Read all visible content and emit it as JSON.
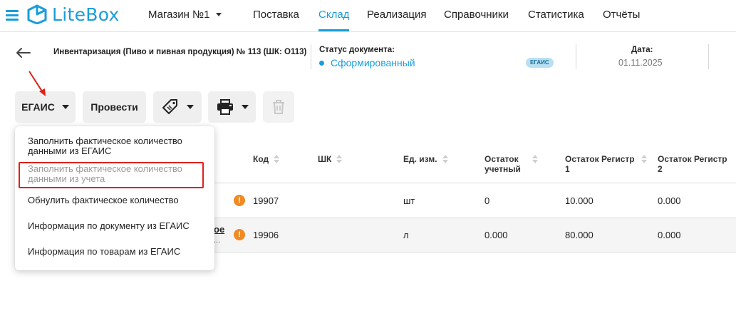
{
  "header": {
    "brand": "LiteBox",
    "store": "Магазин №1",
    "nav": [
      {
        "label": "Поставка"
      },
      {
        "label": "Склад",
        "active": true
      },
      {
        "label": "Реализация"
      },
      {
        "label": "Справочники"
      },
      {
        "label": "Статистика"
      },
      {
        "label": "Отчёты"
      }
    ]
  },
  "document": {
    "title": "Инвентаризация (Пиво и пивная продукция) № 113 (ШК: О113)",
    "status_label": "Статус документа:",
    "status_value": "Сформированный",
    "badge": "ЕГАИС",
    "date_label": "Дата:",
    "date_value": "01.11.2025"
  },
  "toolbar": {
    "egais_label": "ЕГАИС",
    "conduct_label": "Провести",
    "tag_icon": "price-tag-icon",
    "print_icon": "printer-icon",
    "delete_icon": "trash-icon"
  },
  "menu": {
    "items": [
      {
        "label": "Заполнить фактическое количество данными из ЕГАИС",
        "disabled": false
      },
      {
        "label": "Заполнить фактическое количество данными из учета",
        "disabled": true
      },
      {
        "label": "Обнулить фактическое количество",
        "disabled": false
      },
      {
        "label": "Информация по документу из ЕГАИС",
        "disabled": false
      },
      {
        "label": "Информация по товарам из ЕГАИС",
        "disabled": false
      }
    ]
  },
  "table": {
    "columns": [
      "Код",
      "ШК",
      "Ед. изм.",
      "Остаток учетный",
      "Остаток Регистр 1",
      "Остаток Регистр 2"
    ],
    "rows": [
      {
        "name_fragment": "",
        "code": "19907",
        "barcode": "",
        "unit": "шт",
        "stock": "0",
        "reg1": "10.000",
        "reg2": "0.000"
      },
      {
        "name_fragment": "ое",
        "name_fragment2": "...",
        "code": "19906",
        "barcode": "",
        "unit": "л",
        "stock": "0.000",
        "reg1": "80.000",
        "reg2": "0.000"
      }
    ]
  },
  "colors": {
    "accent": "#1a9dd9",
    "warning": "#f08a24",
    "annotation": "#e0201a",
    "badge_bg": "#b9dff2"
  }
}
